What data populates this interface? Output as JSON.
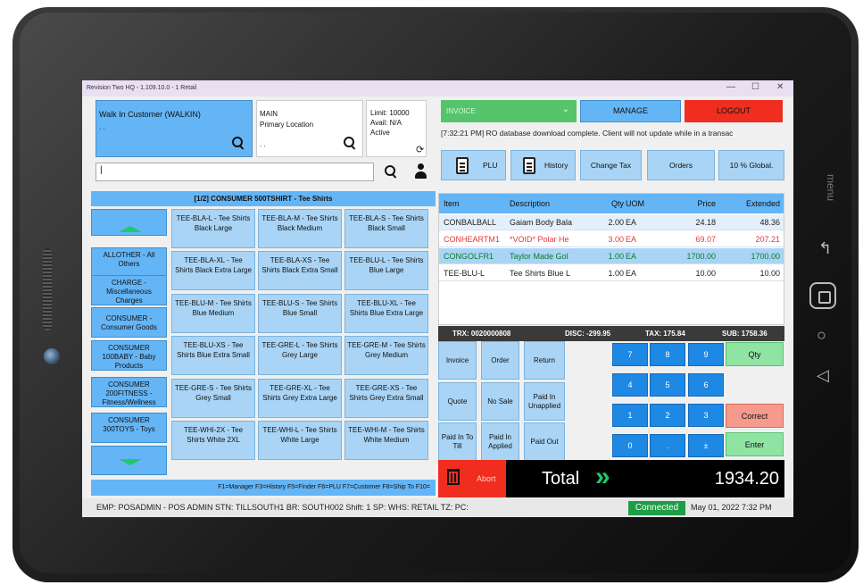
{
  "device": {
    "menu_label": "menu"
  },
  "window": {
    "title": "Revision Two HQ - 1.109.10.0 - 1 Retail",
    "minimize": "—",
    "maximize": "☐",
    "close": "✕"
  },
  "customer": {
    "name": "Walk In Customer (WALKIN)",
    "dots": ". ."
  },
  "location": {
    "line1": "MAIN",
    "line2": "Primary Location",
    "dots": ". ."
  },
  "limit": {
    "limit": "Limit: 10000",
    "avail": "Avail: N/A",
    "status": "Active"
  },
  "search": {
    "value": "|"
  },
  "category": {
    "header": "[1/2] CONSUMER 500TSHIRT - Tee Shirts",
    "buttons": [
      "ALLOTHER - All Others",
      "CHARGE - Miscellaneous Charges",
      "CONSUMER - Consumer Goods",
      "CONSUMER 100BABY - Baby Products",
      "CONSUMER 200FITNESS - Fitness/Wellness",
      "CONSUMER 300TOYS - Toys"
    ]
  },
  "items": [
    "TEE-BLA-L - Tee Shirts Black Large",
    "TEE-BLA-M - Tee Shirts Black Medium",
    "TEE-BLA-S - Tee Shirts Black Small",
    "TEE-BLA-XL - Tee Shirts Black Extra Large",
    "TEE-BLA-XS - Tee Shirts Black Extra Small",
    "TEE-BLU-L - Tee Shirts Blue Large",
    "TEE-BLU-M - Tee Shirts Blue Medium",
    "TEE-BLU-S - Tee Shirts Blue Small",
    "TEE-BLU-XL - Tee Shirts Blue Extra Large",
    "TEE-BLU-XS - Tee Shirts Blue Extra Small",
    "TEE-GRE-L - Tee Shirts Grey Large",
    "TEE-GRE-M - Tee Shirts Grey Medium",
    "TEE-GRE-S - Tee Shirts Grey Small",
    "TEE-GRE-XL - Tee Shirts Grey Extra Large",
    "TEE-GRE-XS - Tee Shirts Grey Extra Small",
    "TEE-WHI-2X - Tee Shirts White 2XL",
    "TEE-WHI-L - Tee Shirts White Large",
    "TEE-WHI-M - Tee Shirts White Medium"
  ],
  "keyhint": "F1=Manager  F3=History  F5=Finder  F6=PLU  F7=Customer  F8=Ship To  F10=",
  "top": {
    "invoice": "INVOICE",
    "manage": "MANAGE",
    "logout": "LOGOUT",
    "message": "[7:32:21 PM] RO database download complete. Client will not update while in a transac"
  },
  "toolbar": {
    "plu": "PLU",
    "history": "History",
    "change_tax": "Change Tax",
    "orders": "Orders",
    "global": "10 % Global."
  },
  "grid": {
    "columns": [
      "Item",
      "Description",
      "Qty",
      "UOM",
      "Price",
      "Extended"
    ],
    "rows": [
      {
        "item": "CONBALBALL",
        "desc": "Gaiam Body Bala",
        "qty": "2.00",
        "uom": "EA",
        "price": "24.18",
        "ext": "48.36",
        "style": "normal"
      },
      {
        "item": "CONHEARTM1",
        "desc": "*VOID* Polar He",
        "qty": "3.00",
        "uom": "EA",
        "price": "69.07",
        "ext": "207.21",
        "style": "void"
      },
      {
        "item": "CONGOLFR1",
        "desc": "Taylor Made Gol",
        "qty": "1.00",
        "uom": "EA",
        "price": "1700.00",
        "ext": "1700.00",
        "style": "selected"
      },
      {
        "item": "TEE-BLU-L",
        "desc": "Tee Shirts Blue  L",
        "qty": "1.00",
        "uom": "EA",
        "price": "10.00",
        "ext": "10.00",
        "style": "white"
      }
    ]
  },
  "summary": {
    "trx": "TRX:   0020000808",
    "disc": "DISC:   -299.95",
    "tax": "TAX:   175.84",
    "sub": "SUB:   1758.36"
  },
  "actions": [
    "Invoice",
    "Order",
    "Return",
    "Quote",
    "No Sale",
    "Paid In Unapplied",
    "Paid In To Till",
    "Paid In Applied",
    "Paid Out"
  ],
  "keypad": [
    "7",
    "8",
    "9",
    "4",
    "5",
    "6",
    "1",
    "2",
    "3",
    "0",
    ".",
    "±"
  ],
  "sidekeys": {
    "qty": "Qty",
    "correct": "Correct",
    "enter": "Enter"
  },
  "abort": "Abort",
  "total": {
    "label": "Total",
    "arrows": "»",
    "value": "1934.20"
  },
  "status": {
    "text": "EMP: POSADMIN - POS ADMIN   STN: TILLSOUTH1   BR: SOUTH002   Shift: 1   SP:    WHS: RETAIL   TZ:   PC:",
    "connected": "Connected",
    "datetime": "May 01, 2022 7:32 PM"
  },
  "colors": {
    "accent_blue": "#64b5f6",
    "green": "#56c46b",
    "red": "#f02d1e",
    "keypad_blue": "#1e88e5"
  }
}
